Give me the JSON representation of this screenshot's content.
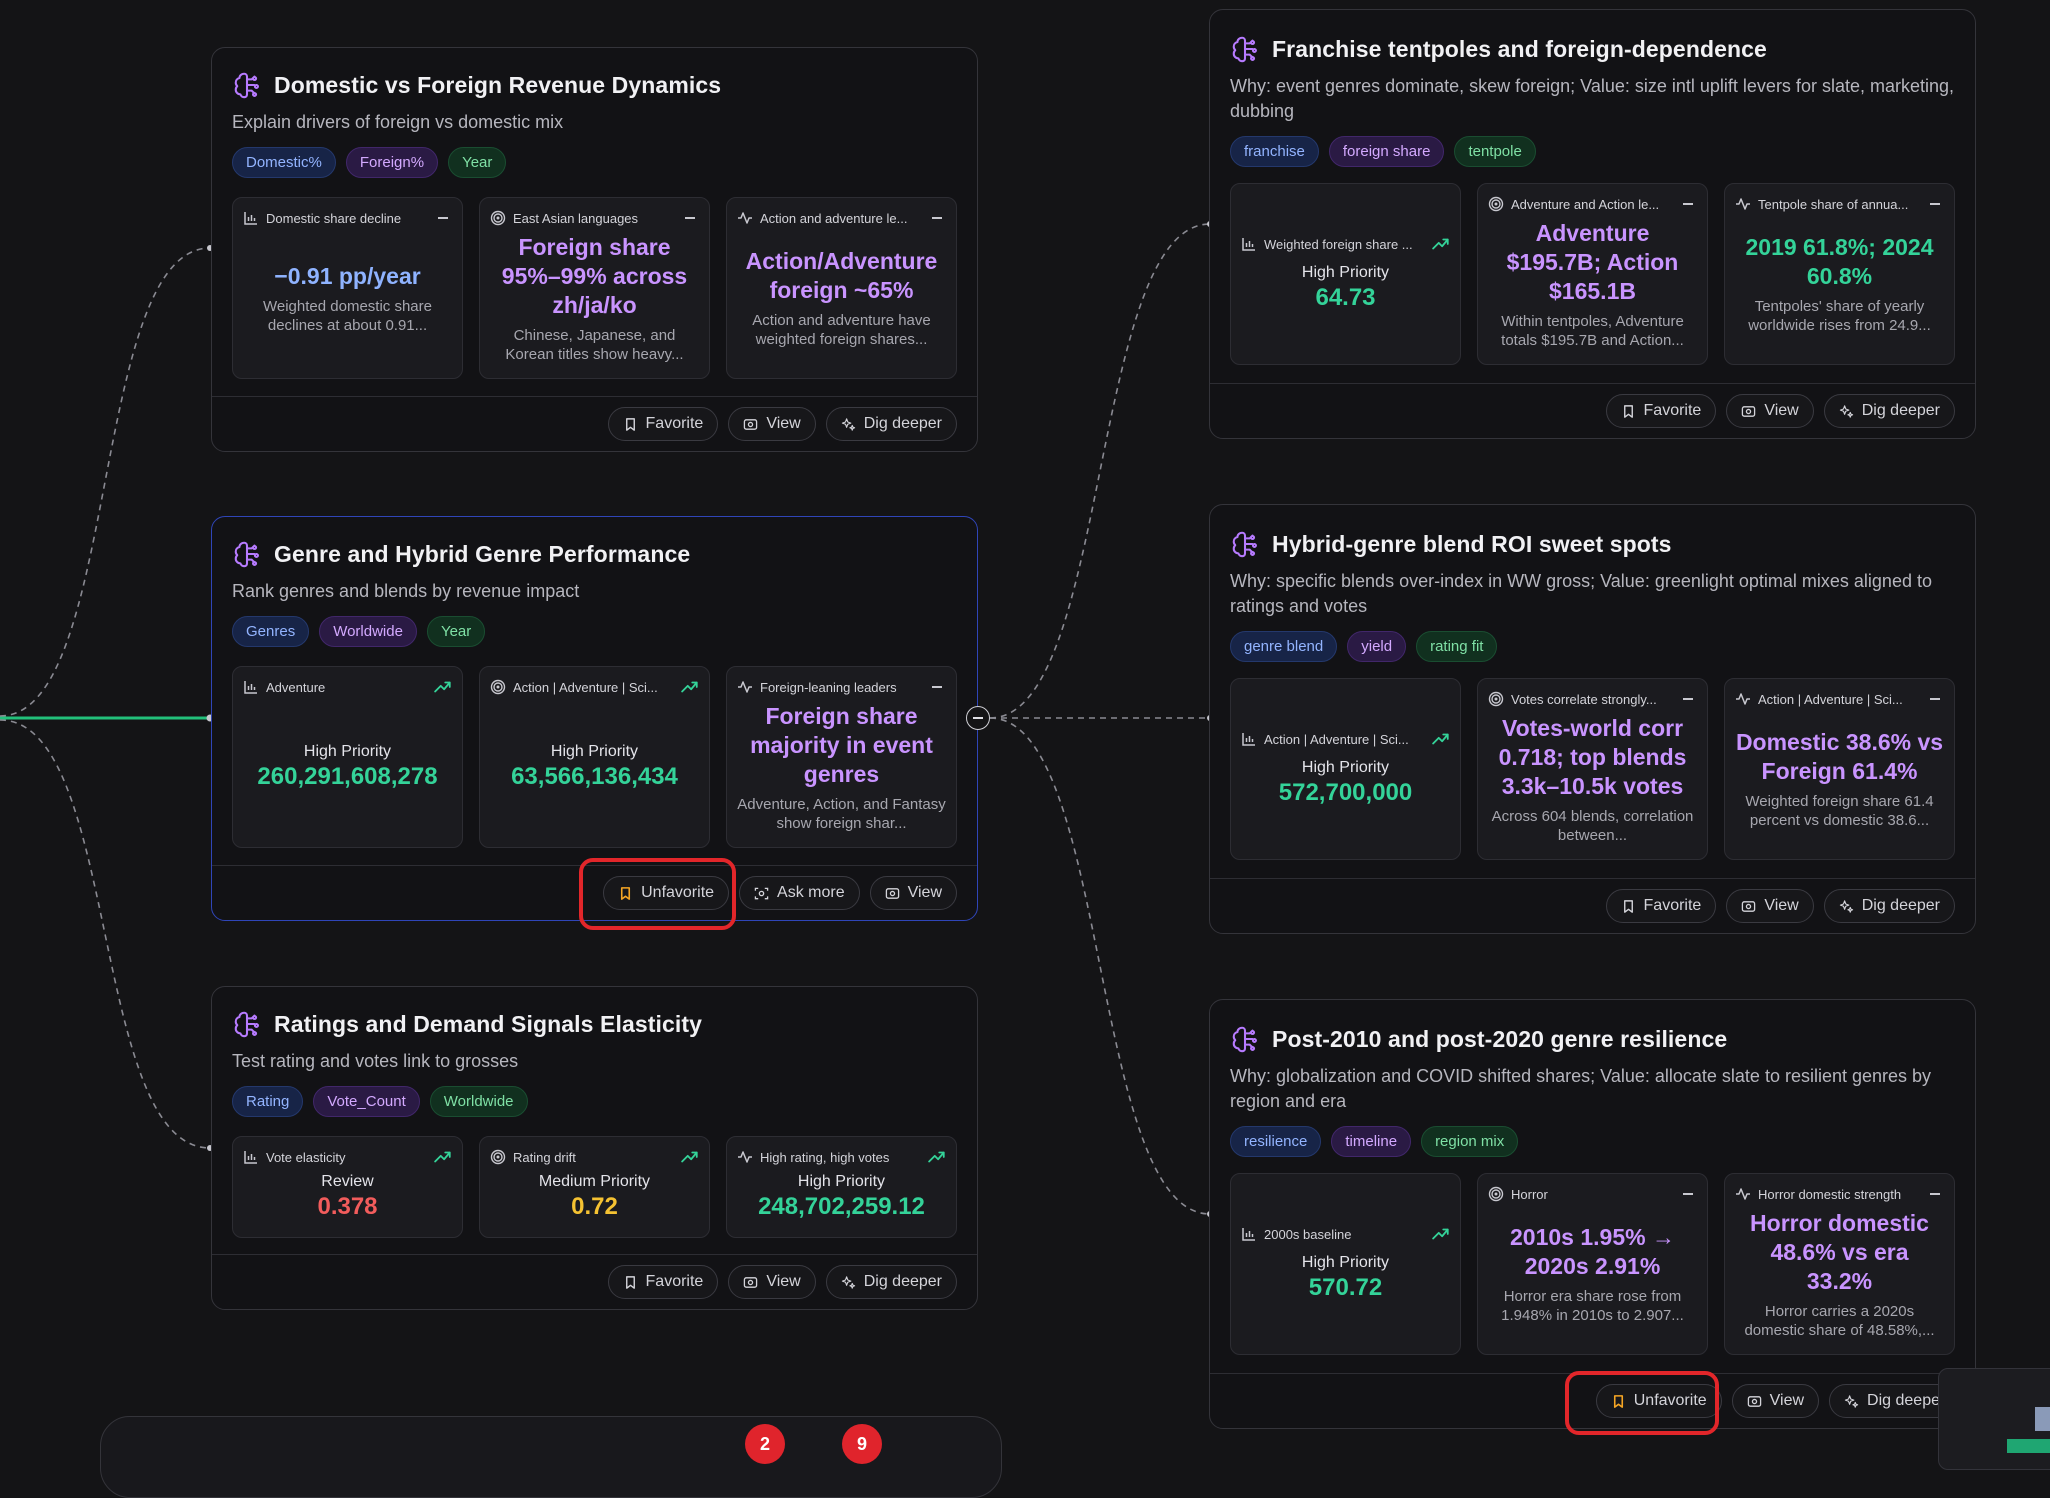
{
  "cards": {
    "c1": {
      "title": "Domestic vs Foreign Revenue Dynamics",
      "subtitle": "Explain drivers of foreign vs domestic mix",
      "tags": [
        "Domestic%",
        "Foreign%",
        "Year"
      ],
      "metrics": [
        {
          "label": "Domestic share decline",
          "headline": "−0.91 pp/year",
          "desc": "Weighted domestic share declines at about 0.91..."
        },
        {
          "label": "East Asian languages",
          "headline": "Foreign share 95%–99% across zh/ja/ko",
          "desc": "Chinese, Japanese, and Korean titles show heavy..."
        },
        {
          "label": "Action and adventure le...",
          "headline": "Action/Adventure foreign ~65%",
          "desc": "Action and adventure have weighted foreign shares..."
        }
      ],
      "buttons": [
        "Favorite",
        "View",
        "Dig deeper"
      ]
    },
    "c2": {
      "title": "Genre and Hybrid Genre Performance",
      "subtitle": "Rank genres and blends by revenue impact",
      "tags": [
        "Genres",
        "Worldwide",
        "Year"
      ],
      "metrics": [
        {
          "label": "Adventure",
          "priority": "High Priority",
          "value": "260,291,608,278"
        },
        {
          "label": "Action | Adventure | Sci...",
          "priority": "High Priority",
          "value": "63,566,136,434"
        },
        {
          "label": "Foreign-leaning leaders",
          "headline": "Foreign share majority in event genres",
          "desc": "Adventure, Action, and Fantasy show foreign shar..."
        }
      ],
      "buttons": [
        "Unfavorite",
        "Ask more",
        "View"
      ]
    },
    "c3": {
      "title": "Ratings and Demand Signals Elasticity",
      "subtitle": "Test rating and votes link to grosses",
      "tags": [
        "Rating",
        "Vote_Count",
        "Worldwide"
      ],
      "metrics": [
        {
          "label": "Vote elasticity",
          "priority": "Review",
          "value": "0.378"
        },
        {
          "label": "Rating drift",
          "priority": "Medium Priority",
          "value": "0.72"
        },
        {
          "label": "High rating, high votes",
          "priority": "High Priority",
          "value": "248,702,259.12"
        }
      ],
      "buttons": [
        "Favorite",
        "View",
        "Dig deeper"
      ]
    },
    "c4": {
      "title": "Franchise tentpoles and foreign-dependence",
      "subtitle": "Why: event genres dominate, skew foreign; Value: size intl uplift levers for slate, marketing, dubbing",
      "tags": [
        "franchise",
        "foreign share",
        "tentpole"
      ],
      "metrics": [
        {
          "label": "Weighted foreign share ...",
          "priority": "High Priority",
          "value": "64.73"
        },
        {
          "label": "Adventure and Action le...",
          "headline": "Adventure $195.7B; Action $165.1B",
          "desc": "Within tentpoles, Adventure totals $195.7B and Action..."
        },
        {
          "label": "Tentpole share of annua...",
          "headline": "2019 61.8%; 2024 60.8%",
          "desc": "Tentpoles' share of yearly worldwide rises from 24.9..."
        }
      ],
      "buttons": [
        "Favorite",
        "View",
        "Dig deeper"
      ]
    },
    "c5": {
      "title": "Hybrid-genre blend ROI sweet spots",
      "subtitle": "Why: specific blends over-index in WW gross; Value: greenlight optimal mixes aligned to ratings and votes",
      "tags": [
        "genre blend",
        "yield",
        "rating fit"
      ],
      "metrics": [
        {
          "label": "Action | Adventure | Sci...",
          "priority": "High Priority",
          "value": "572,700,000"
        },
        {
          "label": "Votes correlate strongly...",
          "headline": "Votes-world corr 0.718; top blends 3.3k–10.5k votes",
          "desc": "Across 604 blends, correlation between..."
        },
        {
          "label": "Action | Adventure | Sci...",
          "headline": "Domestic 38.6% vs Foreign 61.4%",
          "desc": "Weighted foreign share 61.4 percent vs domestic 38.6..."
        }
      ],
      "buttons": [
        "Favorite",
        "View",
        "Dig deeper"
      ]
    },
    "c6": {
      "title": "Post-2010 and post-2020 genre resilience",
      "subtitle": "Why: globalization and COVID shifted shares; Value: allocate slate to resilient genres by region and era",
      "tags": [
        "resilience",
        "timeline",
        "region mix"
      ],
      "metrics": [
        {
          "label": "2000s baseline",
          "priority": "High Priority",
          "value": "570.72"
        },
        {
          "label": "Horror",
          "headline": "2010s 1.95% → 2020s 2.91%",
          "desc": "Horror era share rose from 1.948% in 2010s to 2.907..."
        },
        {
          "label": "Horror domestic strength",
          "headline": "Horror domestic 48.6% vs era 33.2%",
          "desc": "Horror carries a 2020s domestic share of 48.58%,..."
        }
      ],
      "buttons": [
        "Unfavorite",
        "View",
        "Dig deepe"
      ]
    }
  },
  "dock_badges": [
    "2",
    "9"
  ],
  "colors": {
    "accent_purple": "#c994ff",
    "accent_green": "#34d399",
    "accent_blue": "#8fb3ff",
    "review_red": "#f25c5c",
    "medium_yellow": "#f5c232",
    "highlight_red": "#e2262a",
    "edge_green": "#22c55e"
  }
}
